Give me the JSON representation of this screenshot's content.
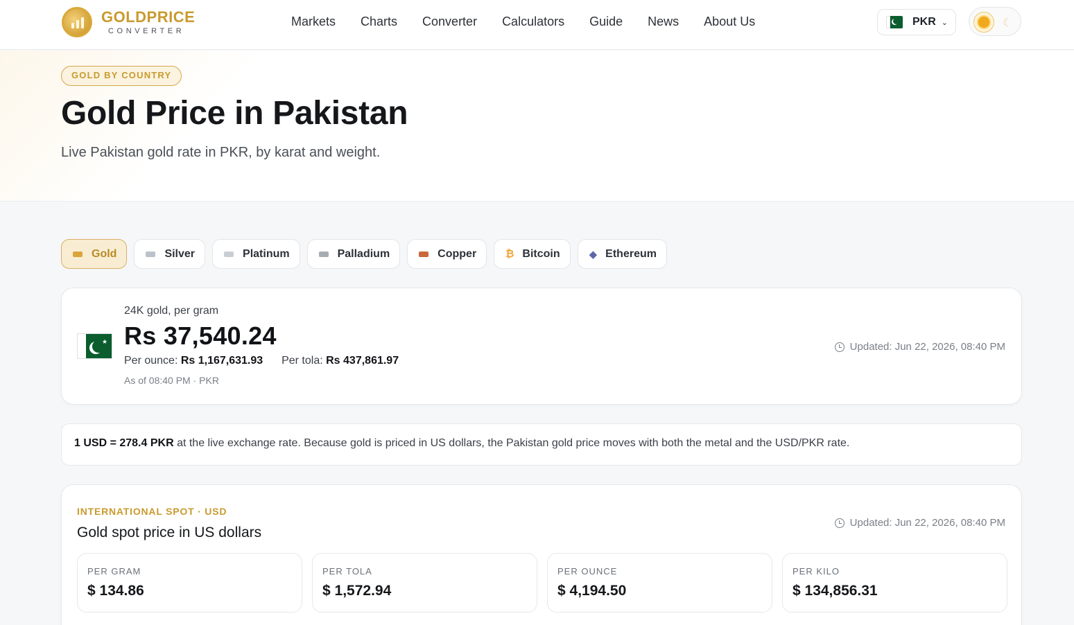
{
  "header": {
    "logo_title": "GOLDPRICE",
    "logo_sub": "CONVERTER",
    "nav": [
      "Markets",
      "Charts",
      "Converter",
      "Calculators",
      "Guide",
      "News",
      "About Us"
    ],
    "currency": "PKR"
  },
  "hero": {
    "tag": "GOLD BY COUNTRY",
    "title": "Gold Price in Pakistan",
    "subtitle": "Live Pakistan gold rate in PKR, by karat and weight."
  },
  "tabs": [
    "Gold",
    "Silver",
    "Platinum",
    "Palladium",
    "Copper",
    "Bitcoin",
    "Ethereum"
  ],
  "price_card": {
    "label": "24K gold, per gram",
    "value": "Rs 37,540.24",
    "per_ounce_label": "Per ounce:",
    "per_ounce_value": "Rs 1,167,631.93",
    "per_tola_label": "Per tola:",
    "per_tola_value": "Rs 437,861.97",
    "as_of": "As of 08:40 PM · PKR",
    "updated": "Updated: Jun 22, 2026, 08:40 PM"
  },
  "note": {
    "rate": "1 USD = 278.4 PKR",
    "text": " at the live exchange rate. Because gold is priced in US dollars, the Pakistan gold price moves with both the metal and the USD/PKR rate."
  },
  "spot": {
    "tag": "INTERNATIONAL SPOT · USD",
    "title": "Gold spot price in US dollars",
    "updated": "Updated: Jun 22, 2026, 08:40 PM",
    "tiles": [
      {
        "label": "PER GRAM",
        "value": "$ 134.86"
      },
      {
        "label": "PER TOLA",
        "value": "$ 1,572.94"
      },
      {
        "label": "PER OUNCE",
        "value": "$ 4,194.50"
      },
      {
        "label": "PER KILO",
        "value": "$ 134,856.31"
      }
    ]
  },
  "colors": {
    "accent_gold": "#c99a2e",
    "active_tab_bg": "#f8edd2",
    "pakistan_green": "#0b5d2e"
  },
  "icons": [
    "logo-coin-icon",
    "pakistan-flag-icon",
    "chevron-down-icon",
    "sun-icon",
    "moon-icon",
    "gold-bar-icon",
    "silver-bar-icon",
    "platinum-bar-icon",
    "palladium-bar-icon",
    "copper-bar-icon",
    "bitcoin-icon",
    "ethereum-icon",
    "clock-icon"
  ]
}
